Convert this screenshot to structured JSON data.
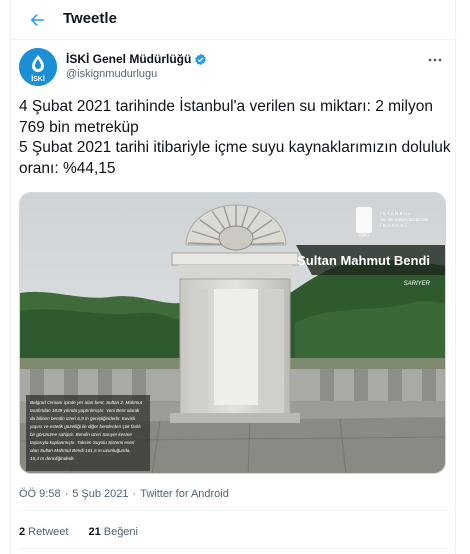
{
  "header": {
    "title": "Tweetle"
  },
  "author": {
    "name": "İSKİ Genel Müdürlüğü",
    "handle": "@iskignmudurlugu",
    "avatar_text": "İSKİ"
  },
  "tweet": {
    "lines": [
      "4 Şubat 2021 tarihinde İstanbul'a verilen su miktarı: 2 milyon 769 bin metreküp",
      "5 Şubat 2021 tarihi itibariyle içme suyu kaynaklarımızın doluluk oranı: %44,15"
    ]
  },
  "media": {
    "logo_text": "İSKİ",
    "org_lines": [
      "İSTANBUL",
      "SU VE KANALİZASYON",
      "İDARESİ"
    ],
    "title": "Sultan Mahmut Bendi",
    "location": "SARIYER",
    "caption": [
      "Belgrad Ormanı içinde yer alan bent, Sultan 2. Mahmut",
      "tarafından 1839 yılında yaptırılmıştır. Yeni Bent olarak",
      "da bilinen bendin üzeri 6,9 m genişliğindedir. Kavisli",
      "yapısı ve estetik güzelliği ile diğer bentlerden çok farklı",
      "bir görünüme sahiptir. Bendin üzeri Sarıyer kesme",
      "taşlarıyla kaplanmıştır. Taksim Suyolu Sistemi eseri",
      "olan Sultan Mahmut Bendi 101,5 m uzunluğunda,",
      "15,4 m derinliğindedir."
    ]
  },
  "meta": {
    "time": "ÖÖ 9:58",
    "dot": "·",
    "date": "5 Şub 2021",
    "source": "Twitter for Android"
  },
  "stats": {
    "retweets": "2",
    "retweets_label": "Retweet",
    "likes": "21",
    "likes_label": "Beğeni"
  },
  "colors": {
    "accent": "#1d9bf0",
    "text": "#0f1419",
    "secondary": "#536471"
  }
}
